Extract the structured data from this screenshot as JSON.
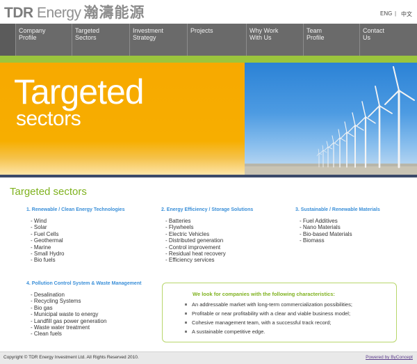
{
  "logo": {
    "en1": "TDR",
    "en2": " Energy",
    "cn": "瀚濤能源"
  },
  "lang": {
    "eng": "ENG",
    "sep": "|",
    "cn": "中文"
  },
  "nav": [
    {
      "line1": "Company",
      "line2": "Profile"
    },
    {
      "line1": "Targeted",
      "line2": "Sectors"
    },
    {
      "line1": "Investment",
      "line2": "Strategy"
    },
    {
      "line1": "Projects",
      "line2": ""
    },
    {
      "line1": "Why Work",
      "line2": "With Us"
    },
    {
      "line1": "Team",
      "line2": "Profile"
    },
    {
      "line1": "Contact",
      "line2": "Us"
    }
  ],
  "hero": {
    "line1": "Targeted",
    "line2": "sectors"
  },
  "page_title": "Targeted sectors",
  "columns": [
    {
      "title": "1. Renewable / Clean Energy Technologies",
      "items": [
        "- Wind",
        "- Solar",
        "- Fuel Cells",
        "- Geothermal",
        "- Marine",
        "- Small Hydro",
        "- Bio fuels"
      ]
    },
    {
      "title": "2. Energy Efficiency / Storage Solutions",
      "items": [
        "- Batteries",
        "- Flywheels",
        "- Electric Vehicles",
        "- Distributed generation",
        "- Control improvement",
        "- Residual heat recovery",
        "- Efficiency services"
      ]
    },
    {
      "title": "3. Sustainable / Renewable Materials",
      "items": [
        "- Fuel Additives",
        "- Nano Materials",
        "- Bio-based Materials",
        "- Biomass"
      ]
    },
    {
      "title": "4. Pollution Control System & Waste Management",
      "items": [
        "- Desalination",
        "- Recycling Systems",
        "- Bio gas",
        "- Municipal waste to energy",
        "- Landfill gas power generation",
        "- Waste water treatment",
        "- Clean fuels"
      ]
    }
  ],
  "characteristics": {
    "title": "We look for companies with the following characteristics:",
    "items": [
      "An addressable market with long-term commercialization possibilities;",
      "Profitable or near profitability with a clear and viable business model;",
      "Cohesive management team, with a successful track record;",
      "A sustainable competitive edge."
    ]
  },
  "footer": {
    "copyright": "Copyright © TDR Energy Investment Ltd. All Rights Reserved 2010.",
    "powered": "Powered by ByConcept"
  },
  "colors": {
    "nav_bg": "#6a6a6a",
    "green": "#9bc53d",
    "orange": "#f7a900",
    "title_green": "#7fb21f",
    "link_blue": "#3a8fd8"
  }
}
